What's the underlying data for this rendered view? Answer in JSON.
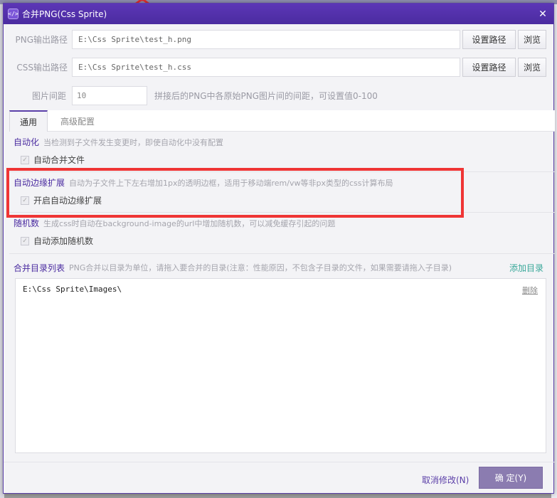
{
  "window": {
    "title": "合并PNG(Css Sprite)",
    "icon": "code-icon",
    "close_glyph": "✕"
  },
  "png_output": {
    "label": "PNG输出路径",
    "value": "E:\\Css Sprite\\test_h.png",
    "set_path_label": "设置路径",
    "browse_label": "浏览"
  },
  "css_output": {
    "label": "CSS输出路径",
    "value": "E:\\Css Sprite\\test_h.css",
    "set_path_label": "设置路径",
    "browse_label": "浏览"
  },
  "spacing": {
    "label": "图片间距",
    "value": "10",
    "hint": "拼接后的PNG中各原始PNG图片间的间距，可设置值0-100"
  },
  "tabs": [
    {
      "label": "通用",
      "active": true
    },
    {
      "label": "高级配置",
      "active": false
    }
  ],
  "automation": {
    "title": "自动化",
    "desc": "当检测到子文件发生变更时，即使自动化中没有配置",
    "checkbox_label": "自动合并文件",
    "checked": true
  },
  "edge_expand": {
    "title": "自动边缘扩展",
    "desc": "自动为子文件上下左右增加1px的透明边框，适用于移动端rem/vw等非px类型的css计算布局",
    "checkbox_label": "开启自动边缘扩展",
    "checked": true
  },
  "random": {
    "title": "随机数",
    "desc": "生成css时自动在background-image的url中增加随机数，可以减免缓存引起的问题",
    "checkbox_label": "自动添加随机数",
    "checked": true
  },
  "dir_list": {
    "title": "合并目录列表",
    "desc": "PNG合并以目录为单位，请拖入要合并的目录(注意：性能原因，不包含子目录的文件，如果需要请拖入子目录)",
    "add_label": "添加目录",
    "items": [
      {
        "path": "E:\\Css Sprite\\Images\\",
        "delete_label": "删除"
      }
    ]
  },
  "footer": {
    "cancel_label": "取消修改(N)",
    "ok_label": "确 定(Y)"
  },
  "colors": {
    "title_bar": "#4b2ca0",
    "accent": "#5b3fa8",
    "highlight": "#ef3535",
    "add_link": "#3aa89a"
  }
}
